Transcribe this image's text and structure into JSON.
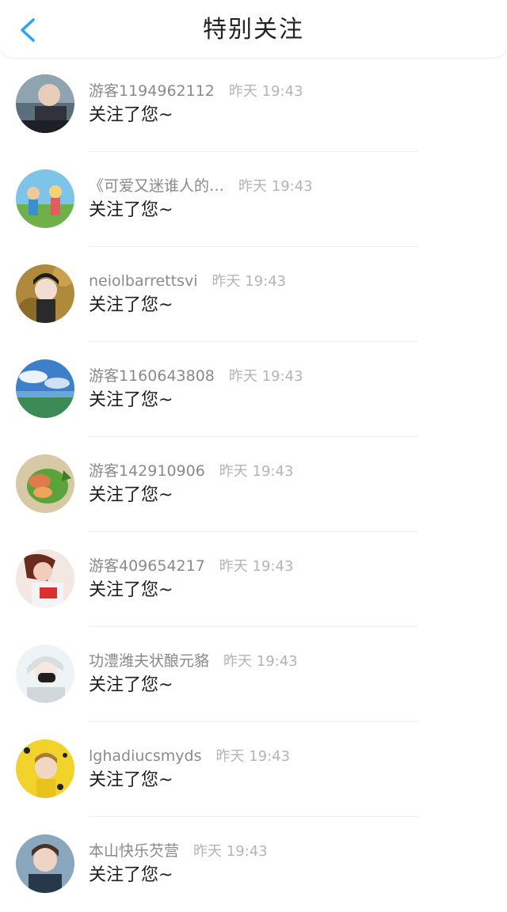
{
  "header": {
    "title": "特别关注",
    "back_icon": "chevron-left-icon",
    "accent_color": "#2aa3f5"
  },
  "notifications": [
    {
      "name": "游客1194962112",
      "time": "昨天 19:43",
      "message": "关注了您~",
      "avatar": "avatar-icon"
    },
    {
      "name": "《可爱又迷谁人的…",
      "time": "昨天 19:43",
      "message": "关注了您~",
      "avatar": "avatar-icon"
    },
    {
      "name": "neiolbarrettsvi",
      "time": "昨天 19:43",
      "message": "关注了您~",
      "avatar": "avatar-icon"
    },
    {
      "name": "游客1160643808",
      "time": "昨天 19:43",
      "message": "关注了您~",
      "avatar": "avatar-icon"
    },
    {
      "name": "游客142910906",
      "time": "昨天 19:43",
      "message": "关注了您~",
      "avatar": "avatar-icon"
    },
    {
      "name": "游客409654217",
      "time": "昨天 19:43",
      "message": "关注了您~",
      "avatar": "avatar-icon"
    },
    {
      "name": "功澧潍夫状酿元貉",
      "time": "昨天 19:43",
      "message": "关注了您~",
      "avatar": "avatar-icon"
    },
    {
      "name": "lghadiucsmyds",
      "time": "昨天 19:43",
      "message": "关注了您~",
      "avatar": "avatar-icon"
    },
    {
      "name": "本山快乐芡营",
      "time": "昨天 19:43",
      "message": "关注了您~",
      "avatar": "avatar-icon"
    }
  ]
}
